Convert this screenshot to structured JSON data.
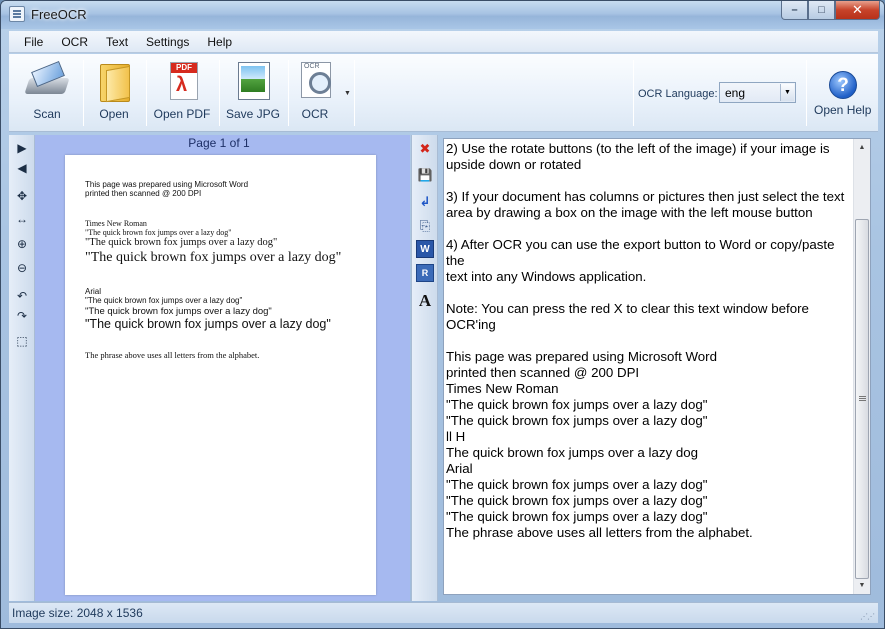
{
  "window": {
    "title": "FreeOCR",
    "min": "–",
    "max": "□",
    "close": "✕"
  },
  "menu": [
    "File",
    "OCR",
    "Text",
    "Settings",
    "Help"
  ],
  "toolbar": {
    "scan": "Scan",
    "open": "Open",
    "open_pdf": "Open PDF",
    "save_jpg": "Save JPG",
    "ocr": "OCR",
    "ocr_dropdown": "▼",
    "language_label": "OCR Language:",
    "language_value": "eng",
    "open_help": "Open Help",
    "help_glyph": "?"
  },
  "left_tools": [
    "▶",
    "◀",
    "✥",
    "↔",
    "⊕",
    "⊖",
    "↶",
    "↷",
    "⬚"
  ],
  "image_pane": {
    "page_label": "Page 1 of 1",
    "page_lines": {
      "l1": "This page was prepared using Microsoft Word",
      "l2": "printed then scanned @ 200 DPI",
      "tnr": "Times New Roman",
      "tnr_small": "\"The quick brown fox jumps over a lazy dog\"",
      "tnr_medium": "\"The quick brown fox jumps over a lazy dog\"",
      "tnr_large": "\"The quick brown fox jumps over a lazy dog\"",
      "arial": "Arial",
      "arial_small": "\"The quick brown fox jumps over a lazy dog\"",
      "arial_medium": "\"The quick brown fox  jumps over a lazy dog\"",
      "arial_large": "\"The quick brown fox jumps over a lazy dog\"",
      "footer": "The phrase above uses all letters from the alphabet."
    }
  },
  "mid_tools": {
    "clear": "✖",
    "save": "💾",
    "enter": "↲",
    "copy": "⎘",
    "word": "W",
    "rtf": "R",
    "font": "A"
  },
  "text_lines": [
    "2) Use the rotate buttons (to the left of the image) if your image is",
    "upside down or rotated",
    "",
    "3) If your document has columns or pictures then just select the text",
    "area by drawing a box on the image with the left mouse button",
    "",
    "4) After OCR you can use the export button to Word or copy/paste the",
    "text into any Windows application.",
    "",
    "Note: You can press the red X to clear this text window before",
    "OCR'ing",
    "",
    "This page was prepared using Microsoft Word",
    "printed then scanned @ 200 DPI",
    "Times New Roman",
    "\"The quick brown fox jumps over a lazy dog\"",
    "\"The quick brown fox jumps over a lazy dog\"",
    "ll H",
    "The quick brown fox jumps over a lazy dog",
    "Arial",
    "\"The quick brown fox jumps over a lazy dog\"",
    "\"The quick brown fox jumps over a lazy dog\"",
    "\"The quick brown fox jumps over a lazy dog\"",
    "The phrase above uses all letters from the alphabet."
  ],
  "scroll": {
    "up": "▲",
    "down": "▼"
  },
  "status": {
    "text": "Image size:  2048  x  1536",
    "grip": "⋰⋰"
  }
}
